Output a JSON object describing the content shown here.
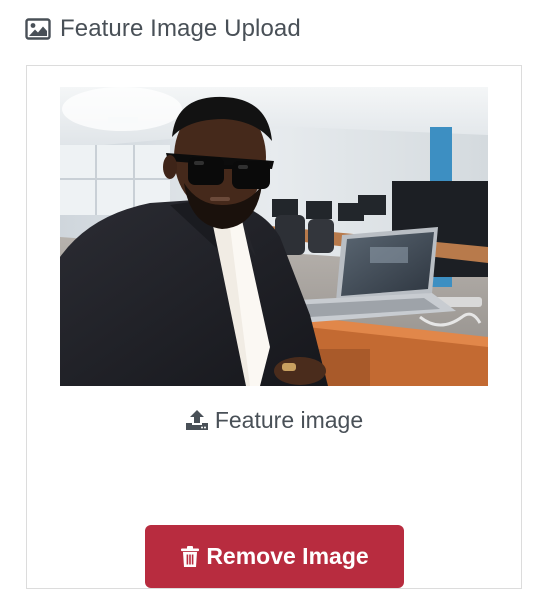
{
  "header": {
    "icon": "image-icon",
    "title": "Feature Image Upload"
  },
  "preview": {
    "alt": "Uploaded feature image preview"
  },
  "upload": {
    "icon": "upload-icon",
    "label": "Feature image"
  },
  "remove_button": {
    "icon": "trash-icon",
    "label": "Remove Image",
    "color": "#b82c3f"
  },
  "colors": {
    "text": "#495057",
    "border": "#dcdcdc",
    "danger": "#b82c3f"
  }
}
